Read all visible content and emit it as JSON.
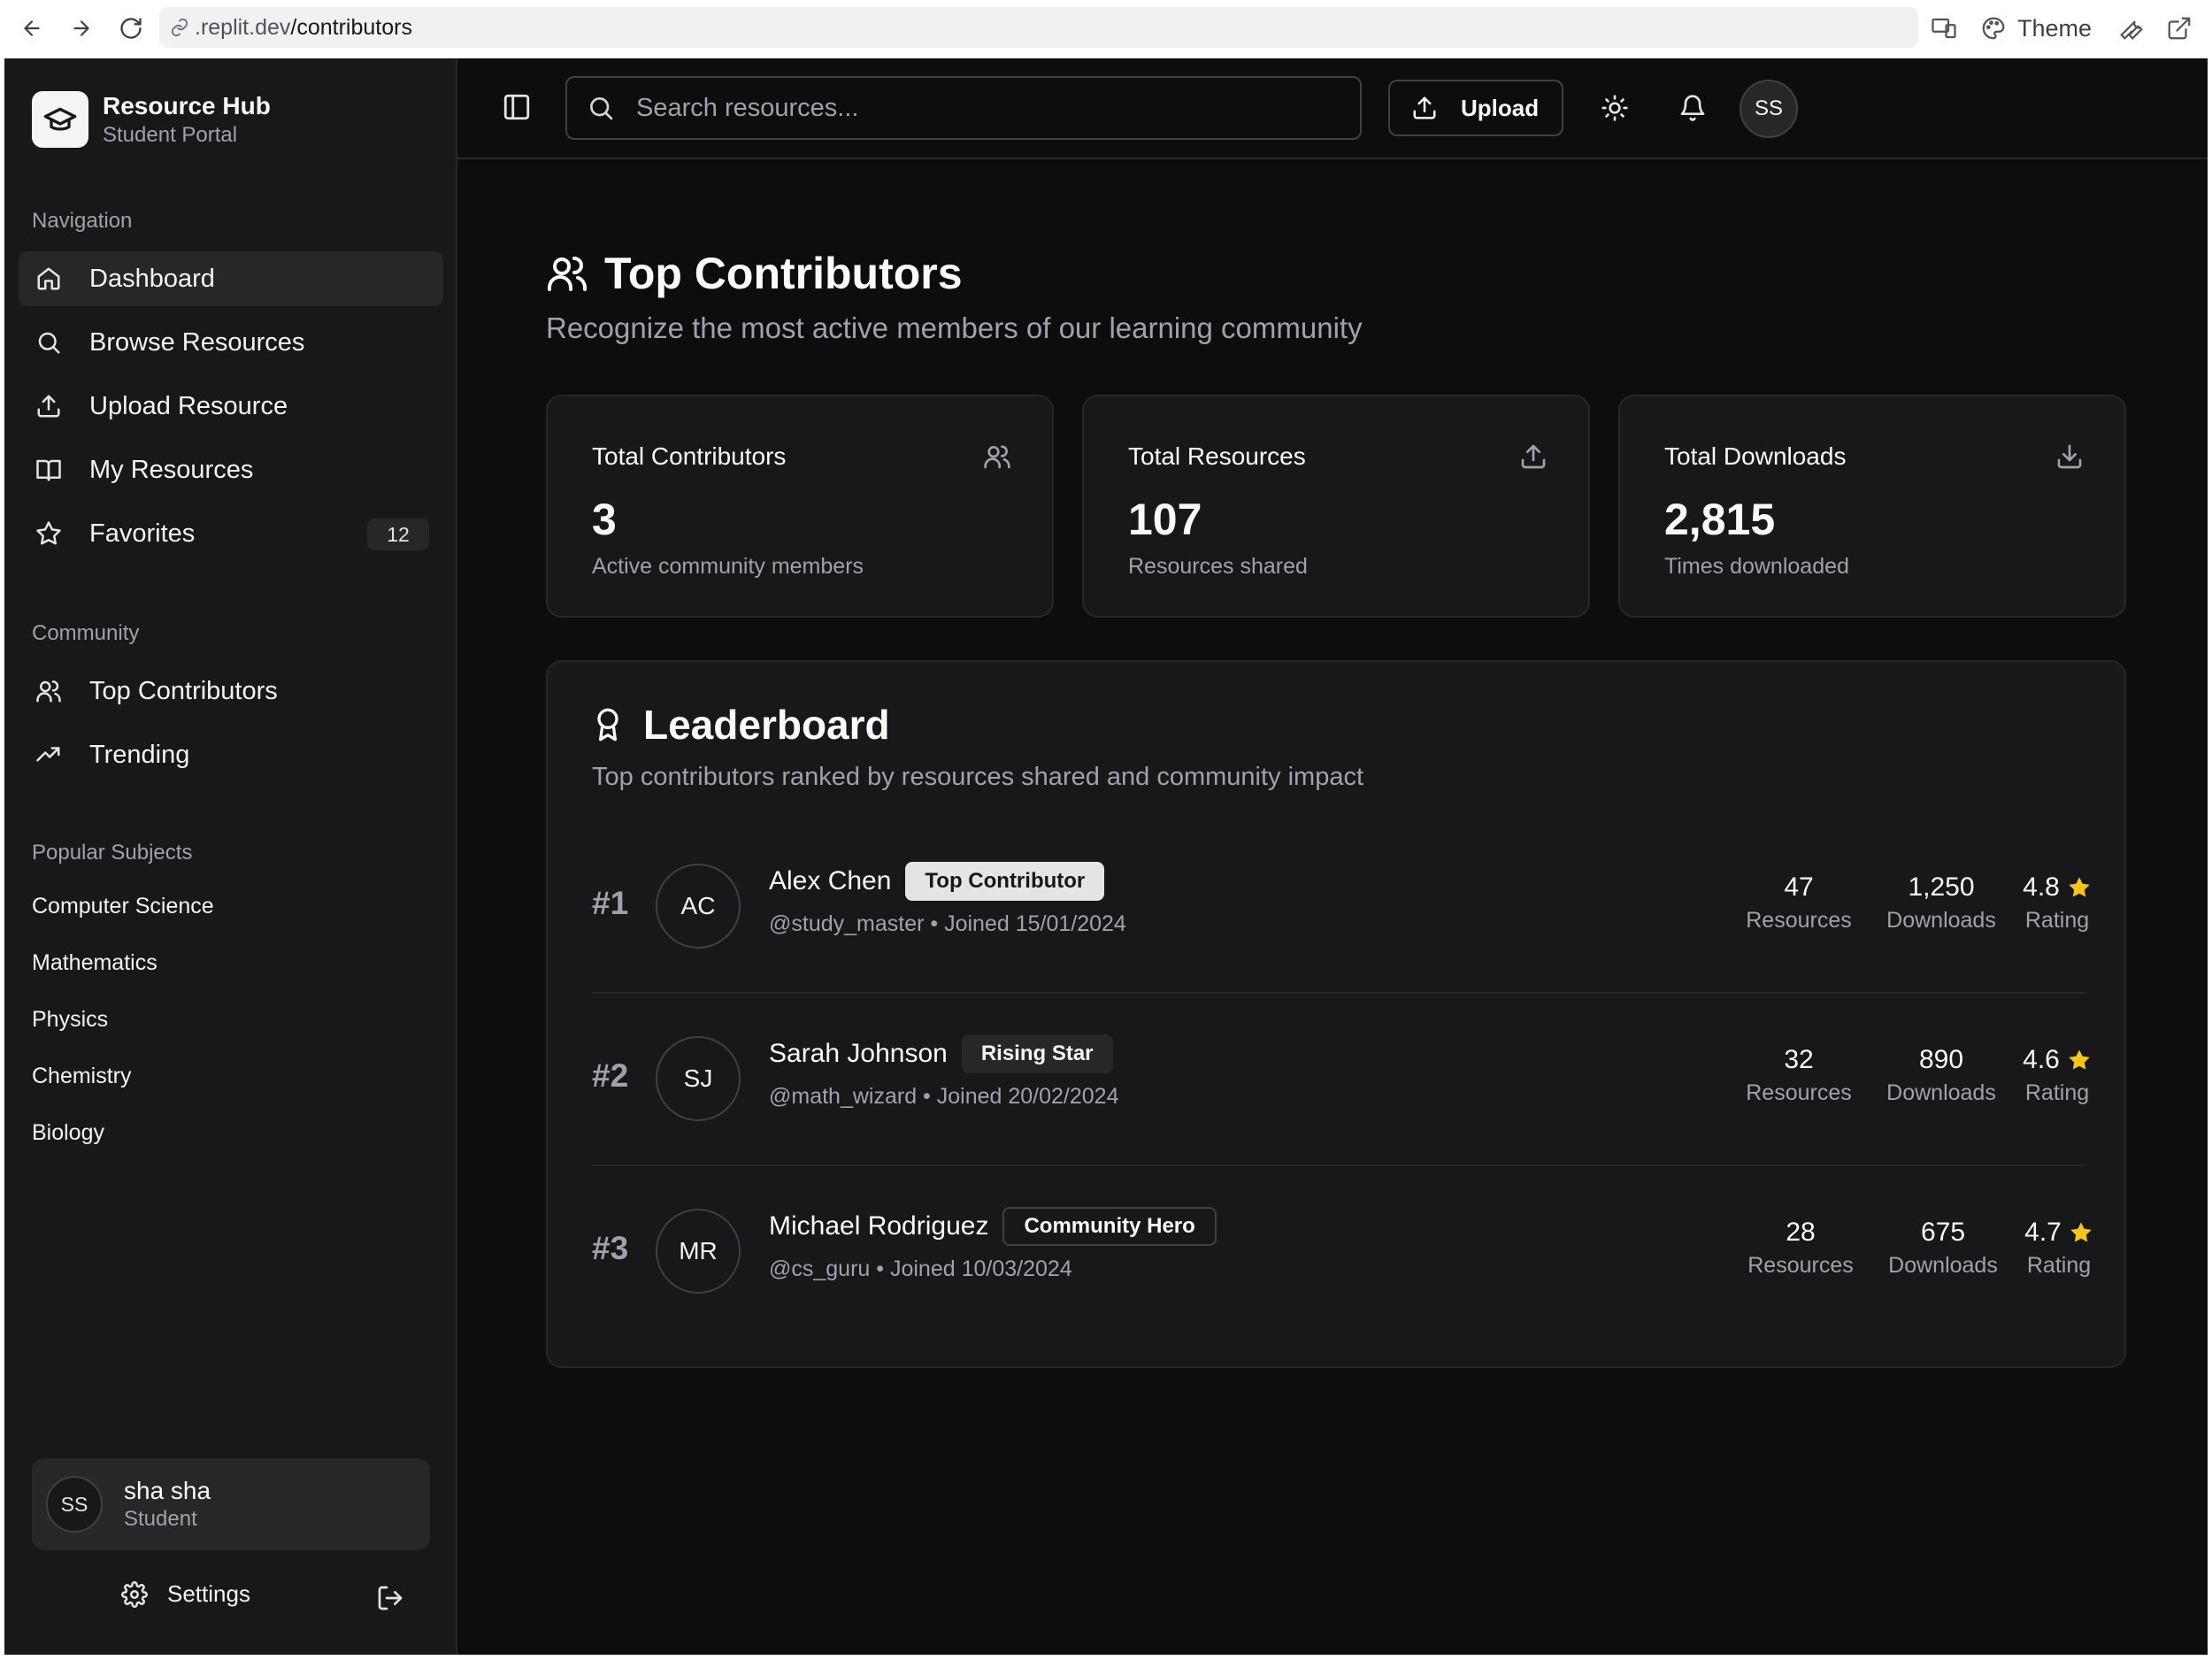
{
  "browser": {
    "url_prefix": ".replit.dev",
    "url_path": "/contributors",
    "theme_label": "Theme"
  },
  "colors": {
    "background": "#0d0d0f",
    "surface": "#18181b",
    "border": "#27272a",
    "muted_text": "#a1a1aa",
    "star": "#f5c518"
  },
  "brand": {
    "title": "Resource Hub",
    "subtitle": "Student Portal"
  },
  "sidebar": {
    "navigation_label": "Navigation",
    "nav_items": [
      {
        "label": "Dashboard",
        "icon": "home-icon"
      },
      {
        "label": "Browse Resources",
        "icon": "search-icon"
      },
      {
        "label": "Upload Resource",
        "icon": "upload-icon"
      },
      {
        "label": "My Resources",
        "icon": "book-icon"
      },
      {
        "label": "Favorites",
        "icon": "star-icon",
        "badge": "12"
      }
    ],
    "community_label": "Community",
    "community_items": [
      {
        "label": "Top Contributors",
        "icon": "users-icon"
      },
      {
        "label": "Trending",
        "icon": "trending-icon"
      }
    ],
    "subjects_label": "Popular Subjects",
    "subjects": [
      "Computer Science",
      "Mathematics",
      "Physics",
      "Chemistry",
      "Biology"
    ],
    "user": {
      "initials": "SS",
      "name": "sha sha",
      "role": "Student"
    },
    "settings_label": "Settings"
  },
  "topbar": {
    "search_placeholder": "Search resources...",
    "upload_label": "Upload",
    "avatar_initials": "SS"
  },
  "page": {
    "title": "Top Contributors",
    "subtitle": "Recognize the most active members of our learning community"
  },
  "stats": [
    {
      "label": "Total Contributors",
      "value": "3",
      "caption": "Active community members",
      "icon": "users-icon"
    },
    {
      "label": "Total Resources",
      "value": "107",
      "caption": "Resources shared",
      "icon": "upload-icon"
    },
    {
      "label": "Total Downloads",
      "value": "2,815",
      "caption": "Times downloaded",
      "icon": "download-icon"
    }
  ],
  "leaderboard": {
    "title": "Leaderboard",
    "subtitle": "Top contributors ranked by resources shared and community impact",
    "metric_labels": {
      "resources": "Resources",
      "downloads": "Downloads",
      "rating": "Rating"
    },
    "rows": [
      {
        "rank": "#1",
        "initials": "AC",
        "name": "Alex Chen",
        "badge": "Top Contributor",
        "meta": "@study_master • Joined 15/01/2024",
        "resources": "47",
        "downloads": "1,250",
        "rating": "4.8"
      },
      {
        "rank": "#2",
        "initials": "SJ",
        "name": "Sarah Johnson",
        "badge": "Rising Star",
        "meta": "@math_wizard • Joined 20/02/2024",
        "resources": "32",
        "downloads": "890",
        "rating": "4.6"
      },
      {
        "rank": "#3",
        "initials": "MR",
        "name": "Michael Rodriguez",
        "badge": "Community Hero",
        "meta": "@cs_guru • Joined 10/03/2024",
        "resources": "28",
        "downloads": "675",
        "rating": "4.7"
      }
    ]
  }
}
